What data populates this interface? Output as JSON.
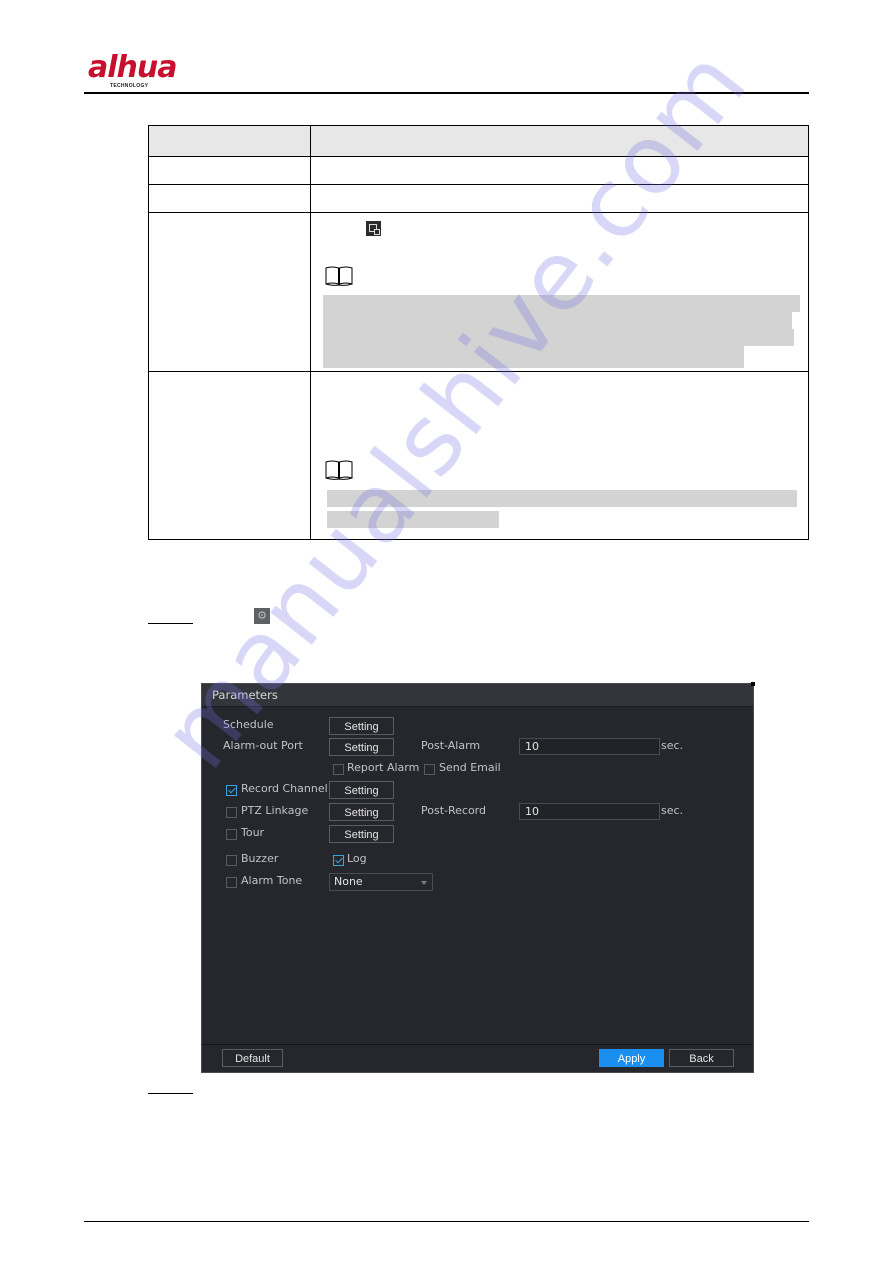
{
  "header": {
    "logo_text": "alhua",
    "logo_subtext": "TECHNOLOGY",
    "brand_color": "#c8102e"
  },
  "table": {
    "header": [
      "",
      ""
    ],
    "rows": [
      {
        "parameter": "",
        "description": ""
      },
      {
        "parameter": "",
        "description": ""
      },
      {
        "parameter": "",
        "description": "",
        "inline_icon": "copy-icon",
        "note_icon": "book-note-icon",
        "note_highlight_lines": 4
      },
      {
        "parameter": "",
        "description": "",
        "note_icon": "book-note-icon",
        "note_highlight_lines": 2
      }
    ]
  },
  "steps": {
    "step_a_icon": "gear-icon",
    "gear_glyph": "⚙"
  },
  "dialog": {
    "title": "Parameters",
    "schedule": {
      "label": "Schedule",
      "button": "Setting"
    },
    "alarm_out_port": {
      "label": "Alarm-out Port",
      "button": "Setting",
      "post_alarm_label": "Post-Alarm",
      "post_alarm_value": "10",
      "unit": "sec."
    },
    "report_alarm": {
      "label": "Report Alarm",
      "checked": false
    },
    "send_email": {
      "label": "Send Email",
      "checked": false
    },
    "record_channel": {
      "label": "Record Channel",
      "checked": true,
      "button": "Setting"
    },
    "ptz_linkage": {
      "label": "PTZ Linkage",
      "checked": false,
      "button": "Setting",
      "post_record_label": "Post-Record",
      "post_record_value": "10",
      "unit": "sec."
    },
    "tour": {
      "label": "Tour",
      "checked": false,
      "button": "Setting"
    },
    "buzzer": {
      "label": "Buzzer",
      "checked": false
    },
    "log": {
      "label": "Log",
      "checked": true
    },
    "alarm_tone": {
      "label": "Alarm Tone",
      "checked": false,
      "selected": "None"
    },
    "footer": {
      "default_label": "Default",
      "apply_label": "Apply",
      "back_label": "Back"
    },
    "accent_color": "#1a8ff0",
    "background_color": "#26272c"
  },
  "watermark": {
    "text": "manualshive.com"
  }
}
